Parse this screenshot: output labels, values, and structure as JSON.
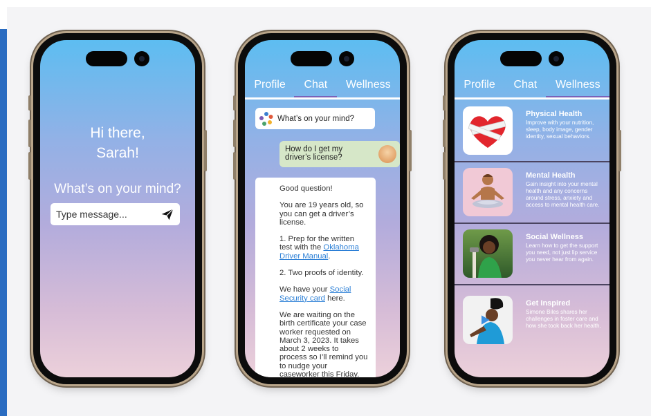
{
  "welcome": {
    "greeting_line1": "Hi there,",
    "greeting_line2": "Sarah!",
    "prompt": "What’s on your mind?",
    "input_placeholder": "Type message..."
  },
  "tabs": [
    "Profile",
    "Chat",
    "Wellness"
  ],
  "chat": {
    "bot_prompt": "What’s on your mind?",
    "user_message": "How do I get my driver’s license?",
    "reply": {
      "p1": "Good question!",
      "p2": "You are 19 years old, so you can get a driver’s license.",
      "p3_pre": "1. Prep for the written test with the ",
      "p3_link": "Oklahoma Driver Manual",
      "p3_post": ".",
      "p4": "2. Two proofs of identity.",
      "p5_pre": "We have your ",
      "p5_link": "Social Security card",
      "p5_post": " here.",
      "p6": "We are waiting on the birth certificate your case worker requested on March 3, 2023. It takes about 2 weeks to process so I’ll remind you to nudge your caseworker this Friday."
    }
  },
  "wellness": [
    {
      "title": "Physical Health",
      "desc": "Improve with your nutrition, sleep, body image, gender identity, sexual behaviors.",
      "icon": "heart-bandage-icon"
    },
    {
      "title": "Mental Health",
      "desc": "Gain insight into your mental health and any concerns around stress, anxiety and access to mental health care.",
      "icon": "meditation-icon"
    },
    {
      "title": "Social Wellness",
      "desc": "Learn how to get the support you need, not just lip service you never hear from again.",
      "icon": "person-photo"
    },
    {
      "title": "Get Inspired",
      "desc": "Simone Biles shares her challenges in foster care and how she took back her health.",
      "icon": "video-thumbnail"
    }
  ],
  "colors": {
    "accent": "#7a62b8",
    "user_bubble": "#d6e7c8",
    "link": "#2b7fd6"
  }
}
